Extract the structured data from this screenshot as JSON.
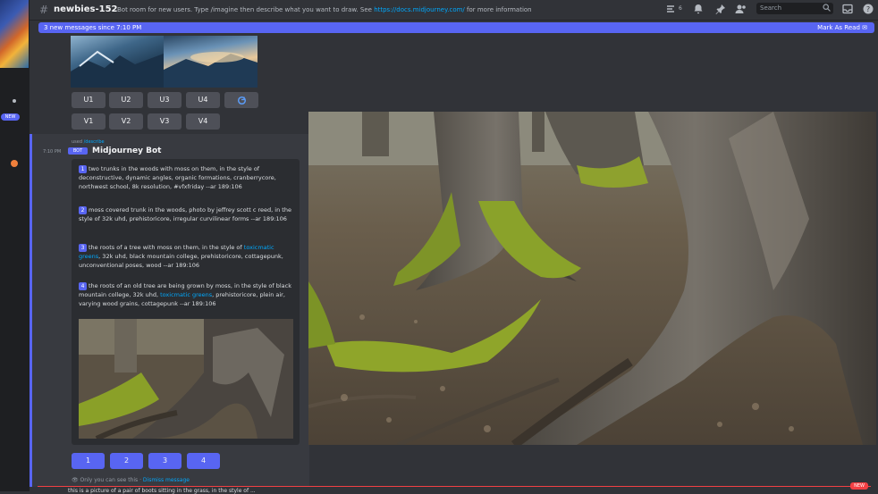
{
  "rail": {
    "new_badge": "NEW"
  },
  "header": {
    "channel_name": "newbies-152",
    "topic_prefix": "Bot room for new users. Type /imagine then describe what you want to draw. See",
    "topic_link": "https://docs.midjourney.com/",
    "topic_suffix": "for more information",
    "member_count": "6",
    "search_placeholder": "Search"
  },
  "banner": {
    "text": "3 new messages since 7:10 PM",
    "mark_read": "Mark As Read"
  },
  "grid_buttons": {
    "upscale": [
      "U1",
      "U2",
      "U3",
      "U4"
    ],
    "variation": [
      "V1",
      "V2",
      "V3",
      "V4"
    ]
  },
  "message": {
    "time": "7:10 PM",
    "reply_used": "used",
    "reply_command": "/describe",
    "bot_tag": "BOT",
    "bot_name": "Midjourney Bot",
    "prompts": [
      {
        "num": "1",
        "text": "two trunks in the woods with moss on them, in the style of deconstructive, dynamic angles, organic formations, cranberrycore, northwest school, 8k resolution, #vfxfriday --ar 189:106"
      },
      {
        "num": "2",
        "text": "moss covered trunk in the woods, photo by jeffrey scott c reed, in the style of 32k uhd, prehistoricore, irregular curvilinear forms --ar 189:106"
      },
      {
        "num": "3",
        "pre": "the roots of a tree with moss on them, in the style of",
        "link": "toxicmatic greens",
        "post": ", 32k uhd, black mountain college, prehistoricore, cottagepunk, unconventional poses, wood --ar 189:106"
      },
      {
        "num": "4",
        "pre": "the roots of an old tree are being grown by moss, in the style of black mountain college, 32k uhd,",
        "link": "toxicmatic greens",
        "post": ", prehistoricore, plein air, varying wood grains, cottagepunk --ar 189:106"
      }
    ],
    "number_buttons": [
      "1",
      "2",
      "3",
      "4"
    ],
    "only_you": "Only you can see this",
    "dismiss": "Dismiss message"
  },
  "bottom": {
    "new_pill": "NEW",
    "text": "this is a picture of a pair of boots sitting in the grass, in the style of ..."
  }
}
